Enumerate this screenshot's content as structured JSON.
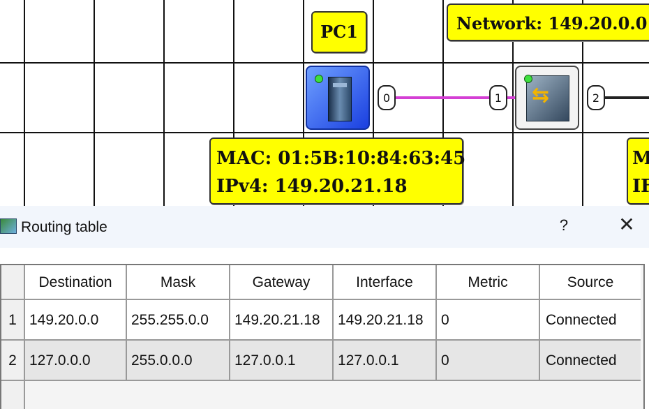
{
  "canvas": {
    "pc_label": "PC1",
    "network_label": "Network: 149.20.0.0",
    "mac_line": "MAC: 01:5B:10:84:63:45",
    "ipv4_line": "IPv4: 149.20.21.18",
    "mac2_partial_line1": "M",
    "mac2_partial_line2": "IF",
    "ports": [
      "0",
      "1",
      "2"
    ],
    "colors": {
      "label_bg": "#ffff00",
      "pc_blue": "#1a3fe0",
      "link_pink": "#d43fd4",
      "led_green": "#3ee03e"
    }
  },
  "dialog": {
    "title": "Routing table",
    "help_label": "?",
    "close_label": "✕",
    "table": {
      "columns": [
        "Destination",
        "Mask",
        "Gateway",
        "Interface",
        "Metric",
        "Source"
      ],
      "rows": [
        {
          "num": "1",
          "cells": [
            "149.20.0.0",
            "255.255.0.0",
            "149.20.21.18",
            "149.20.21.18",
            "0",
            "Connected"
          ]
        },
        {
          "num": "2",
          "cells": [
            "127.0.0.0",
            "255.0.0.0",
            "127.0.0.1",
            "127.0.0.1",
            "0",
            "Connected"
          ]
        }
      ]
    }
  }
}
